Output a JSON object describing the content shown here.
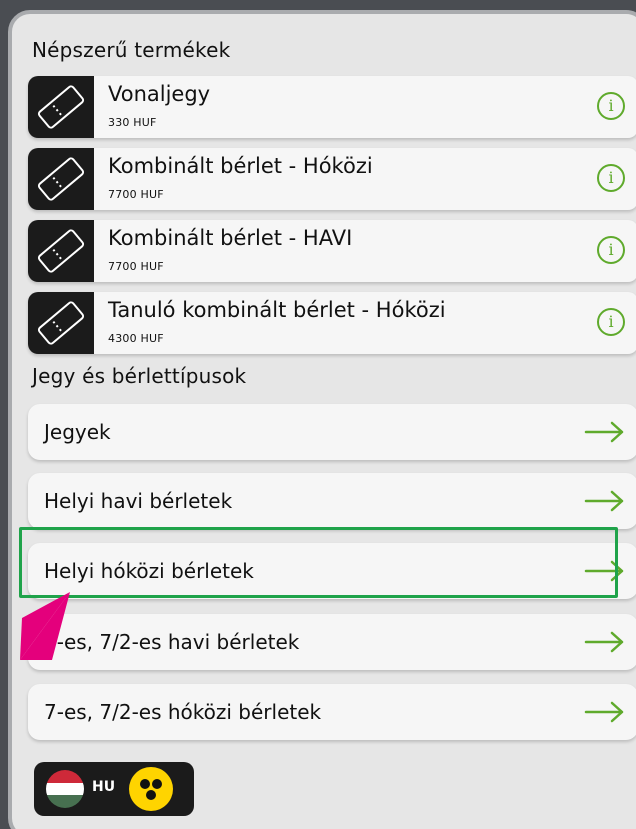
{
  "popular": {
    "title": "Népszerű termékek",
    "products": [
      {
        "name": "Vonaljegy",
        "price": "330 HUF"
      },
      {
        "name": "Kombinált bérlet - Hóközi",
        "price": "7700 HUF"
      },
      {
        "name": "Kombinált bérlet - HAVI",
        "price": "7700 HUF"
      },
      {
        "name": "Tanuló kombinált bérlet - Hóközi",
        "price": "4300 HUF"
      }
    ],
    "info_glyph": "i"
  },
  "types": {
    "title": "Jegy és bérlettípusok",
    "items": [
      {
        "label": "Jegyek"
      },
      {
        "label": "Helyi havi bérletek"
      },
      {
        "label": "Helyi hóközi bérletek"
      },
      {
        "label": "7-es, 7/2-es havi bérletek"
      },
      {
        "label": "7-es, 7/2-es hóközi bérletek"
      }
    ]
  },
  "language": {
    "code": "HU"
  },
  "colors": {
    "accent_green": "#5faa2c",
    "highlight_green": "#1fa34a",
    "pointer_magenta": "#e4007c",
    "accessibility_yellow": "#ffd400"
  }
}
